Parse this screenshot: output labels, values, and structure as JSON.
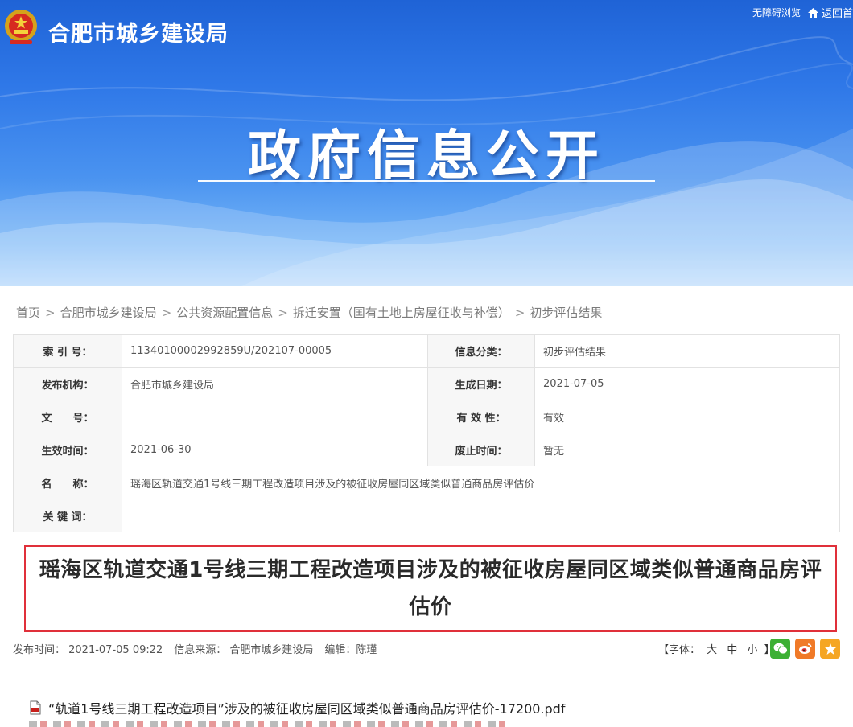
{
  "header": {
    "site_title": "合肥市城乡建设局",
    "accessibility_link": "无障碍浏览",
    "back_link": "返回首",
    "hero_title": "政府信息公开"
  },
  "breadcrumb": {
    "items": [
      "首页",
      "合肥市城乡建设局",
      "公共资源配置信息",
      "拆迁安置（国有土地上房屋征收与补偿）",
      "初步评估结果"
    ],
    "separator": ">"
  },
  "info": {
    "rows": [
      {
        "label": "索 引 号：",
        "value": "11340100002992859U/202107-00005",
        "label2": "信息分类：",
        "value2": "初步评估结果"
      },
      {
        "label": "发布机构：",
        "value": "合肥市城乡建设局",
        "label2": "生成日期：",
        "value2": "2021-07-05"
      },
      {
        "label": "文　　号：",
        "value": "",
        "label2": "有 效 性：",
        "value2": "有效"
      },
      {
        "label": "生效时间：",
        "value": "2021-06-30",
        "label2": "废止时间：",
        "value2": "暂无"
      },
      {
        "label": "名　　称：",
        "value": "瑶海区轨道交通1号线三期工程改造项目涉及的被征收房屋同区域类似普通商品房评估价"
      },
      {
        "label": "关 键 词：",
        "value": ""
      }
    ]
  },
  "article": {
    "title": "瑶海区轨道交通1号线三期工程改造项目涉及的被征收房屋同区域类似普通商品房评估价",
    "publish_time": "发布时间： 2021-07-05 09:22",
    "source": "信息来源： 合肥市城乡建设局",
    "editor": "编辑：陈瑾",
    "font_size_label": "【字体：",
    "font_large": "大",
    "font_medium": "中",
    "font_small": "小",
    "font_close": "】",
    "attachment": "“轨道1号线三期工程改造项目”涉及的被征收房屋同区域类似普通商品房评估价-17200.pdf"
  },
  "colors": {
    "highlight_border": "#e0303a",
    "wechat": "#3cb034",
    "weibo": "#f07a28",
    "favorite": "#f5a623"
  },
  "icons": [
    "emblem-icon",
    "home-icon",
    "wechat-icon",
    "weibo-icon",
    "star-icon",
    "pdf-icon"
  ]
}
